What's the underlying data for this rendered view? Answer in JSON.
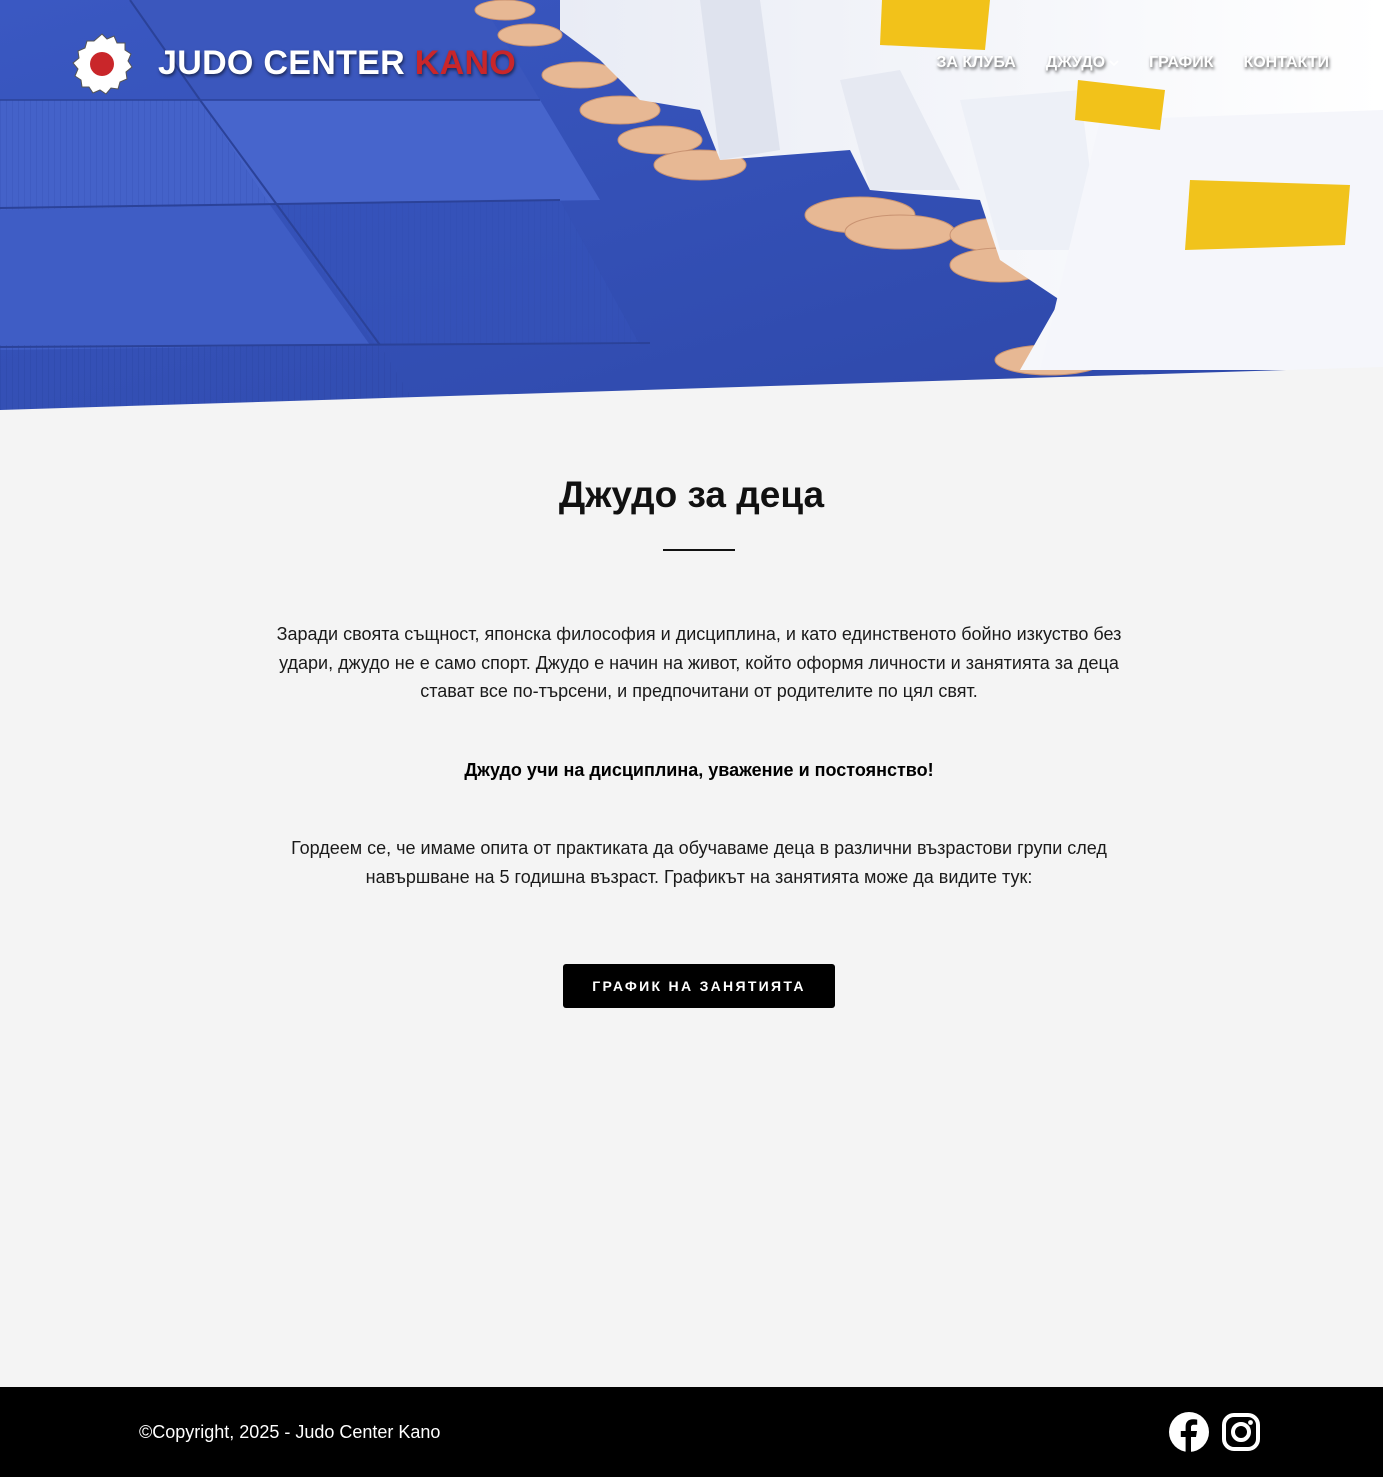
{
  "header": {
    "brand_main": "JUDO CENTER",
    "brand_accent": "KANO",
    "nav": [
      {
        "label": "ЗА КЛУБА"
      },
      {
        "label": "ДЖУДО"
      },
      {
        "label": "ГРАФИК"
      },
      {
        "label": "КОНТАКТИ"
      }
    ]
  },
  "main": {
    "title": "Джудо за деца",
    "paragraph1": "Заради своята същност, японска философия и дисциплина, и като единственото бойно изкуство без удари, джудо не е само спорт. Джудо е начин на живот, който оформя личности и занятията за деца стават все по-търсени, и предпочитани от родителите по цял свят.",
    "paragraph2": "Джудо учи на дисциплина, уважение и постоянство!",
    "paragraph3": "Гордеем се, че имаме опита от практиката да обучаваме деца в различни възрастови групи след навършване на 5 годишна възраст. Графикът на занятията може да видите тук:",
    "button_label": "ГРАФИК НА ЗАНЯТИЯТА"
  },
  "footer": {
    "copyright": "©Copyright, 2025 - Judo Center Kano",
    "social": [
      "facebook-icon",
      "instagram-icon"
    ]
  },
  "colors": {
    "accent_red": "#c9262a",
    "mat_blue": "#3b55b8",
    "page_bg": "#f4f4f4",
    "footer_bg": "#000000"
  }
}
